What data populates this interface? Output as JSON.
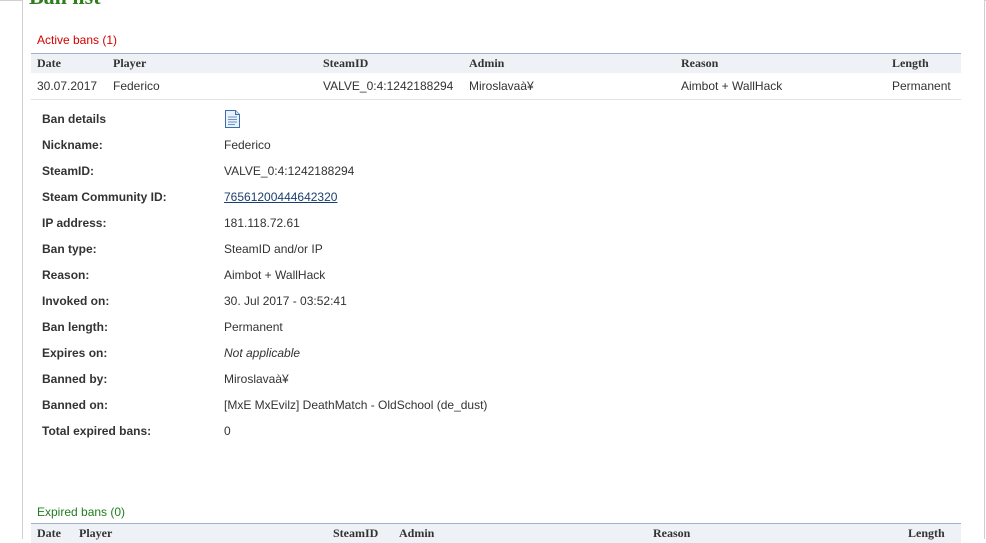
{
  "page": {
    "title": "Ban list"
  },
  "active": {
    "heading": "Active bans (1)",
    "columns": [
      "Date",
      "Player",
      "SteamID",
      "Admin",
      "Reason",
      "Length"
    ],
    "rows": [
      {
        "date": "30.07.2017",
        "player": "Federico",
        "steamid": "VALVE_0:4:1242188294",
        "admin": "Miroslavaà¥",
        "reason": "Aimbot + WallHack",
        "length": "Permanent"
      }
    ]
  },
  "details": {
    "ban_details": "Ban details",
    "nickname_label": "Nickname:",
    "nickname": "Federico",
    "steamid_label": "SteamID:",
    "steamid": "VALVE_0:4:1242188294",
    "community_label": "Steam Community ID:",
    "community": "76561200444642320",
    "ip_label": "IP address:",
    "ip": "181.118.72.61",
    "bantype_label": "Ban type:",
    "bantype": "SteamID and/or IP",
    "reason_label": "Reason:",
    "reason": "Aimbot + WallHack",
    "invoked_label": "Invoked on:",
    "invoked": "30. Jul 2017 - 03:52:41",
    "length_label": "Ban length:",
    "length": "Permanent",
    "expires_label": "Expires on:",
    "expires": "Not applicable",
    "bannedby_label": "Banned by:",
    "bannedby": "Miroslavaà¥",
    "bannedon_label": "Banned on:",
    "bannedon": "[MxE MxEvilz] DeathMatch - OldSchool (de_dust)",
    "expired_total_label": "Total expired bans:",
    "expired_total": "0"
  },
  "expired": {
    "heading": "Expired bans (0)",
    "columns": [
      "Date",
      "Player",
      "SteamID",
      "Admin",
      "Reason",
      "Length"
    ]
  },
  "icons": {
    "details": "document-icon"
  },
  "colors": {
    "active_heading": "#d40000",
    "expired_heading": "#1f7d1f",
    "link": "#1a3f6e",
    "table_header_bg": "#eef1f5"
  }
}
